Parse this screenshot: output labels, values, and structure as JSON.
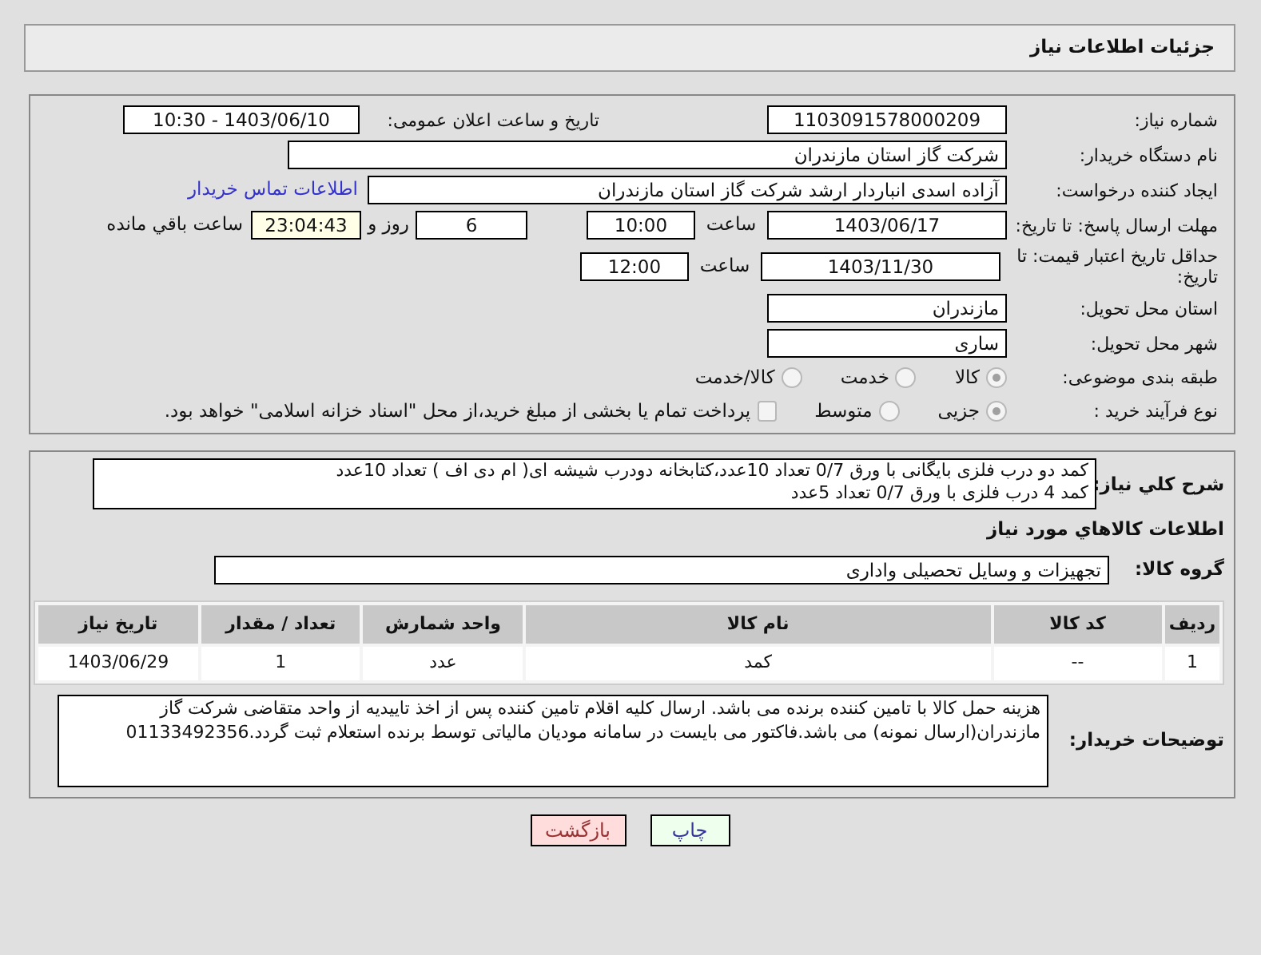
{
  "header": {
    "title": "جزئیات اطلاعات نیاز"
  },
  "need_number": {
    "label": "شماره نیاز:",
    "value": "1103091578000209"
  },
  "announce": {
    "label": "تاریخ و ساعت اعلان عمومی:",
    "value": "1403/06/10 - 10:30"
  },
  "buyer": {
    "label": "نام دستگاه خریدار:",
    "value": "شرکت گاز استان مازندران"
  },
  "creator": {
    "label": "ایجاد کننده درخواست:",
    "value": "آزاده اسدی انباردار ارشد شرکت گاز استان مازندران",
    "link": "اطلاعات تماس خریدار"
  },
  "deadline": {
    "label": "مهلت ارسال پاسخ: تا تاریخ:",
    "date": "1403/06/17",
    "time_label": "ساعت",
    "time": "10:00",
    "days": "6",
    "days_label": "روز و",
    "remaining": "23:04:43",
    "remaining_label": "ساعت باقي مانده"
  },
  "validity": {
    "label": "حداقل تاریخ اعتبار قیمت: تا تاریخ:",
    "date": "1403/11/30",
    "time_label": "ساعت",
    "time": "12:00"
  },
  "province": {
    "label": "استان محل تحویل:",
    "value": "مازندران"
  },
  "city": {
    "label": "شهر محل تحویل:",
    "value": "ساری"
  },
  "category": {
    "label": "طبقه بندی موضوعی:",
    "options": [
      {
        "label": "کالا",
        "selected": true
      },
      {
        "label": "خدمت",
        "selected": false
      },
      {
        "label": "کالا/خدمت",
        "selected": false
      }
    ]
  },
  "process": {
    "label": "نوع فرآیند خرید :",
    "options": [
      {
        "label": "جزیی",
        "selected": true
      },
      {
        "label": "متوسط",
        "selected": false
      }
    ],
    "payment": {
      "checked": false,
      "text": "پرداخت تمام یا بخشی از مبلغ خرید،از محل \"اسناد خزانه اسلامی\" خواهد بود."
    }
  },
  "description": {
    "label": "شرح کلي نياز:",
    "lines": [
      "کمد دو درب فلزی بایگانی با ورق 0/7 تعداد 10عدد،کتابخانه دودرب شیشه ای( ام دی اف ) تعداد 10عدد",
      "کمد 4 درب فلزی با ورق 0/7 تعداد 5عدد"
    ]
  },
  "goods_title": "اطلاعات کالاهاي مورد نياز",
  "goods_group": {
    "label": "گروه کالا:",
    "value": "تجهیزات و وسایل تحصیلی واداری"
  },
  "table": {
    "columns": [
      "ردیف",
      "کد کالا",
      "نام کالا",
      "واحد شمارش",
      "تعداد / مقدار",
      "تاریخ نیاز"
    ],
    "rows": [
      [
        "1",
        "--",
        "کمد",
        "عدد",
        "1",
        "1403/06/29"
      ]
    ]
  },
  "buyer_notes": {
    "label": "توضیحات خریدار:",
    "value": "هزینه حمل کالا با تامین کننده برنده می باشد. ارسال کلیه اقلام تامین کننده پس از اخذ تاییدیه از واحد متقاضی شرکت گاز مازندران(ارسال نمونه) می باشد.فاکتور می بایست در سامانه مودیان مالیاتی توسط برنده استعلام ثبت گردد.01133492356"
  },
  "buttons": [
    {
      "label": "چاپ",
      "kind": "print"
    },
    {
      "label": "بازگشت",
      "kind": "back"
    }
  ]
}
